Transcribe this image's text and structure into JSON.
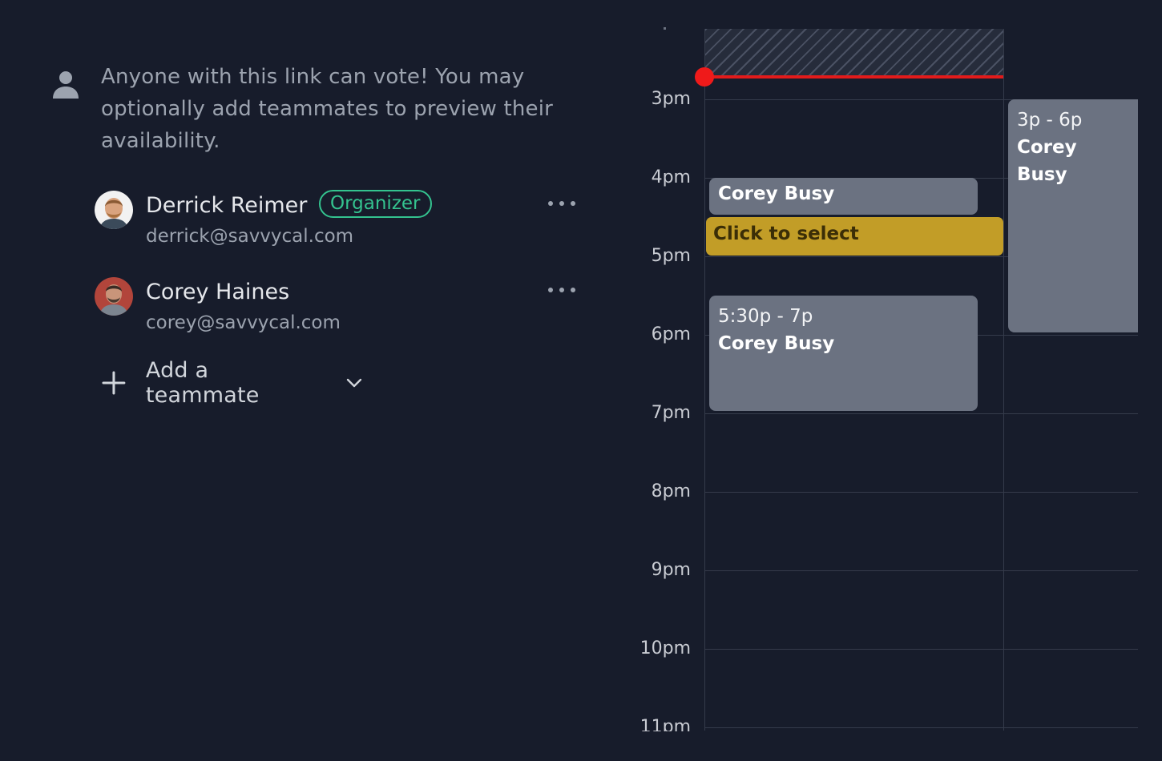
{
  "info": {
    "icon": "person-icon",
    "text": "Anyone with this link can vote! You may optionally add teammates to preview their availability."
  },
  "members": [
    {
      "name": "Derrick Reimer",
      "email": "derrick@savvycal.com",
      "badge": "Organizer",
      "avatar": "avatar-derrick"
    },
    {
      "name": "Corey Haines",
      "email": "corey@savvycal.com",
      "avatar": "avatar-corey"
    }
  ],
  "add_teammate": {
    "label": "Add a teammate",
    "icon": "plus-icon",
    "dropdown_icon": "chevron-down-icon"
  },
  "calendar": {
    "hours": [
      "3pm",
      "4pm",
      "5pm",
      "6pm",
      "7pm",
      "8pm",
      "9pm",
      "10pm",
      "11pm"
    ],
    "events": {
      "a": {
        "title": "Corey Busy"
      },
      "b": {
        "time": "5:30p - 7p",
        "title": "Corey Busy"
      },
      "c": {
        "time": "3p - 6p",
        "title": "Corey Busy"
      }
    },
    "select_slot": {
      "label": "Click to select"
    }
  },
  "colors": {
    "background": "#171c2b",
    "organizer_badge": "#34c38f",
    "busy_event": "#6b7281",
    "select_slot": "#c29d27",
    "now_indicator": "#ef1a1a"
  }
}
